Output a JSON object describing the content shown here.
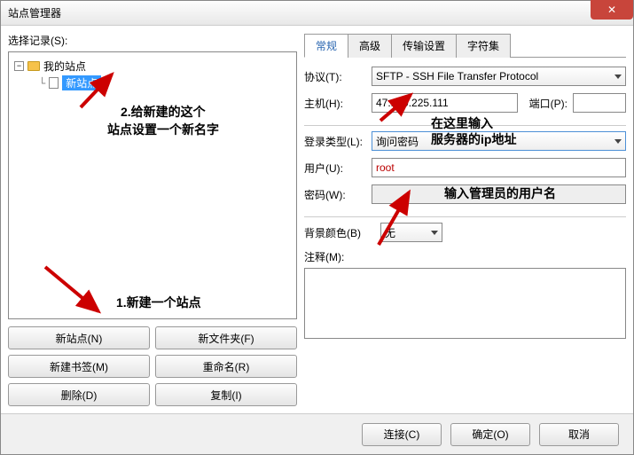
{
  "window": {
    "title": "站点管理器"
  },
  "left": {
    "label": "选择记录(S):",
    "tree": {
      "root": "我的站点",
      "selected": "新站点"
    },
    "buttons": {
      "new_site": "新站点(N)",
      "new_folder": "新文件夹(F)",
      "new_bookmark": "新建书签(M)",
      "rename": "重命名(R)",
      "delete": "删除(D)",
      "copy": "复制(I)"
    }
  },
  "tabs": {
    "general": "常规",
    "advanced": "高级",
    "transfer": "传输设置",
    "charset": "字符集"
  },
  "form": {
    "protocol_label": "协议(T):",
    "protocol_value": "SFTP - SSH File Transfer Protocol",
    "host_label": "主机(H):",
    "host_value": "47.100.225.111",
    "port_label": "端口(P):",
    "port_value": "",
    "logon_label": "登录类型(L):",
    "logon_value": "询问密码",
    "user_label": "用户(U):",
    "user_value": "root",
    "pass_label": "密码(W):",
    "bg_label": "背景颜色(B)",
    "bg_value": "无",
    "comment_label": "注释(M):"
  },
  "bottom": {
    "connect": "连接(C)",
    "ok": "确定(O)",
    "cancel": "取消"
  },
  "annotations": {
    "a1": "1.新建一个站点",
    "a2_l1": "2.给新建的这个",
    "a2_l2": "站点设置一个新名字",
    "a3_l1": "在这里输入",
    "a3_l2": "服务器的ip地址",
    "a4": "输入管理员的用户名"
  }
}
